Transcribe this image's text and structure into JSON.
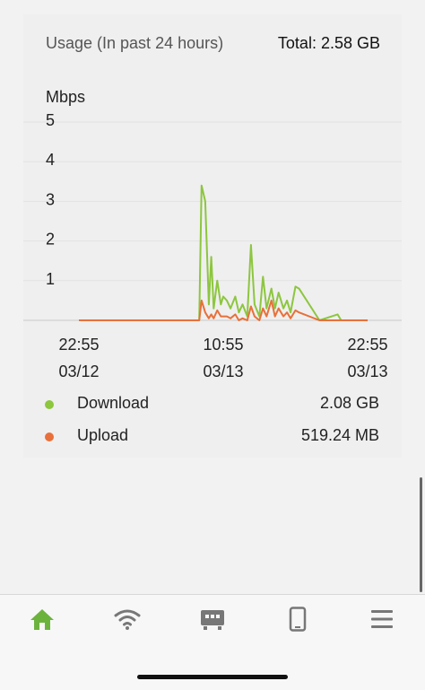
{
  "usage": {
    "title": "Usage (In past 24 hours)",
    "total": "Total: 2.58 GB"
  },
  "chart_data": {
    "type": "line",
    "ylabel": "Mbps",
    "ylim": [
      0,
      5
    ],
    "yticks": [
      "1",
      "2",
      "3",
      "4",
      "5"
    ],
    "xticks": [
      {
        "time": "22:55",
        "date": "03/12"
      },
      {
        "time": "10:55",
        "date": "03/13"
      },
      {
        "time": "22:55",
        "date": "03/13"
      }
    ],
    "x_range_hours": [
      0,
      24
    ],
    "x": [
      0,
      3,
      6,
      9,
      10,
      10.2,
      10.5,
      10.8,
      11,
      11.2,
      11.5,
      11.8,
      12,
      12.3,
      12.6,
      13,
      13.3,
      13.6,
      14,
      14.3,
      14.6,
      15,
      15.3,
      15.6,
      16,
      16.3,
      16.6,
      17,
      17.3,
      17.6,
      18,
      18.3,
      20,
      21.5,
      21.8,
      22,
      24
    ],
    "series": [
      {
        "name": "Download",
        "color": "#8dc63f",
        "values": [
          0,
          0,
          0,
          0,
          0,
          3.4,
          3.0,
          0.4,
          1.6,
          0.3,
          1.0,
          0.4,
          0.6,
          0.5,
          0.3,
          0.6,
          0.2,
          0.4,
          0.1,
          1.9,
          0.4,
          0.1,
          1.1,
          0.3,
          0.8,
          0.3,
          0.7,
          0.3,
          0.5,
          0.2,
          0.85,
          0.8,
          0,
          0.15,
          0,
          0,
          0
        ]
      },
      {
        "name": "Upload",
        "color": "#e8703a",
        "values": [
          0,
          0,
          0,
          0,
          0,
          0.5,
          0.2,
          0.05,
          0.15,
          0.05,
          0.25,
          0.1,
          0.1,
          0.1,
          0.05,
          0.15,
          0,
          0.05,
          0,
          0.35,
          0.1,
          0,
          0.3,
          0.1,
          0.5,
          0.1,
          0.3,
          0.1,
          0.2,
          0.05,
          0.25,
          0.2,
          0,
          0,
          0,
          0,
          0
        ]
      }
    ]
  },
  "legend": [
    {
      "name": "Download",
      "value": "2.08 GB",
      "color": "#8dc63f"
    },
    {
      "name": "Upload",
      "value": "519.24 MB",
      "color": "#e8703a"
    }
  ],
  "tabs": [
    {
      "icon": "home-icon",
      "active": true,
      "color": "#6cb33e"
    },
    {
      "icon": "wifi-icon",
      "active": false,
      "color": "#777777"
    },
    {
      "icon": "router-icon",
      "active": false,
      "color": "#777777"
    },
    {
      "icon": "phone-icon",
      "active": false,
      "color": "#777777"
    },
    {
      "icon": "menu-icon",
      "active": false,
      "color": "#777777"
    }
  ]
}
